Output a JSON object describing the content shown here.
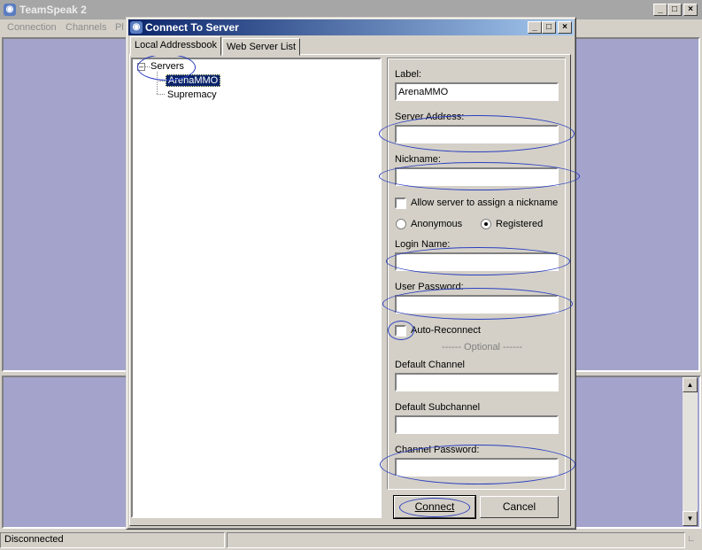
{
  "main_window": {
    "title": "TeamSpeak 2",
    "menu": [
      "Connection",
      "Channels",
      "Pl"
    ],
    "title_buttons": [
      "_",
      "□",
      "×"
    ]
  },
  "status_bar": {
    "text": "Disconnected"
  },
  "dialog": {
    "title": "Connect To Server",
    "title_buttons": [
      "_",
      "□",
      "×"
    ],
    "tabs": [
      "Local Addressbook",
      "Web Server List"
    ],
    "active_tab": "Local Addressbook",
    "tree": {
      "root": "Servers",
      "items": [
        "ArenaMMO",
        "Supremacy"
      ],
      "selected": "ArenaMMO"
    },
    "form": {
      "label_label": "Label:",
      "label_value": "ArenaMMO",
      "server_address_label": "Server Address:",
      "server_address_value": "",
      "nickname_label": "Nickname:",
      "nickname_value": "",
      "allow_nick_label": "Allow server to assign a nickname",
      "allow_nick_checked": false,
      "anonymous_label": "Anonymous",
      "registered_label": "Registered",
      "selected_mode": "Registered",
      "login_name_label": "Login Name:",
      "login_name_value": "",
      "user_password_label": "User Password:",
      "user_password_value": "",
      "auto_reconnect_label": "Auto-Reconnect",
      "auto_reconnect_checked": false,
      "optional_label": "------ Optional ------",
      "default_channel_label": "Default Channel",
      "default_channel_value": "",
      "default_subchannel_label": "Default Subchannel",
      "default_subchannel_value": "",
      "channel_password_label": "Channel Password:",
      "channel_password_value": ""
    },
    "buttons": {
      "connect": "Connect",
      "cancel": "Cancel"
    }
  },
  "colors": {
    "annotation": "#2a3fbf",
    "pane_background": "#a3a3cc",
    "dialog_title": "#0a246a",
    "tree_selection": "#0a246a"
  }
}
